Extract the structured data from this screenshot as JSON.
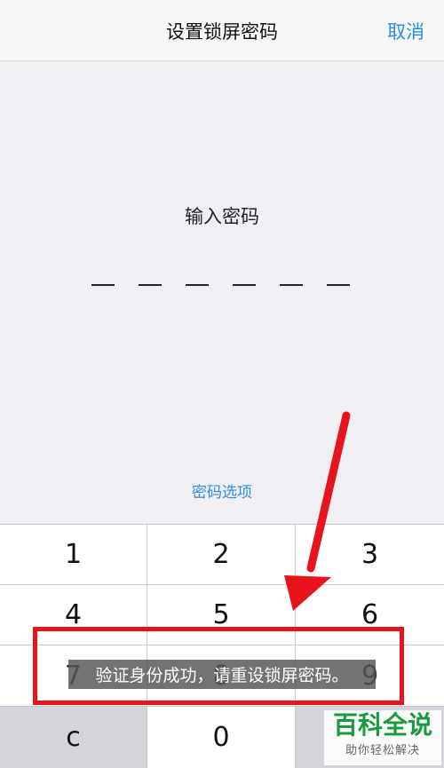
{
  "navbar": {
    "title": "设置锁屏密码",
    "cancel_label": "取消"
  },
  "passcode": {
    "prompt": "输入密码",
    "digits_entered": 0,
    "digits_total": 6,
    "options_label": "密码选项"
  },
  "keypad": {
    "keys": [
      "1",
      "2",
      "3",
      "4",
      "5",
      "6",
      "7",
      "8",
      "9",
      "c",
      "0",
      ""
    ]
  },
  "toast": {
    "message": "验证身份成功，请重设锁屏密码。"
  },
  "annotation": {
    "color": "#e8131b"
  },
  "watermark": {
    "title": "百科全说",
    "subtitle": "助你轻松解决"
  },
  "colors": {
    "accent": "#2c8de0",
    "background": "#efeff4"
  }
}
